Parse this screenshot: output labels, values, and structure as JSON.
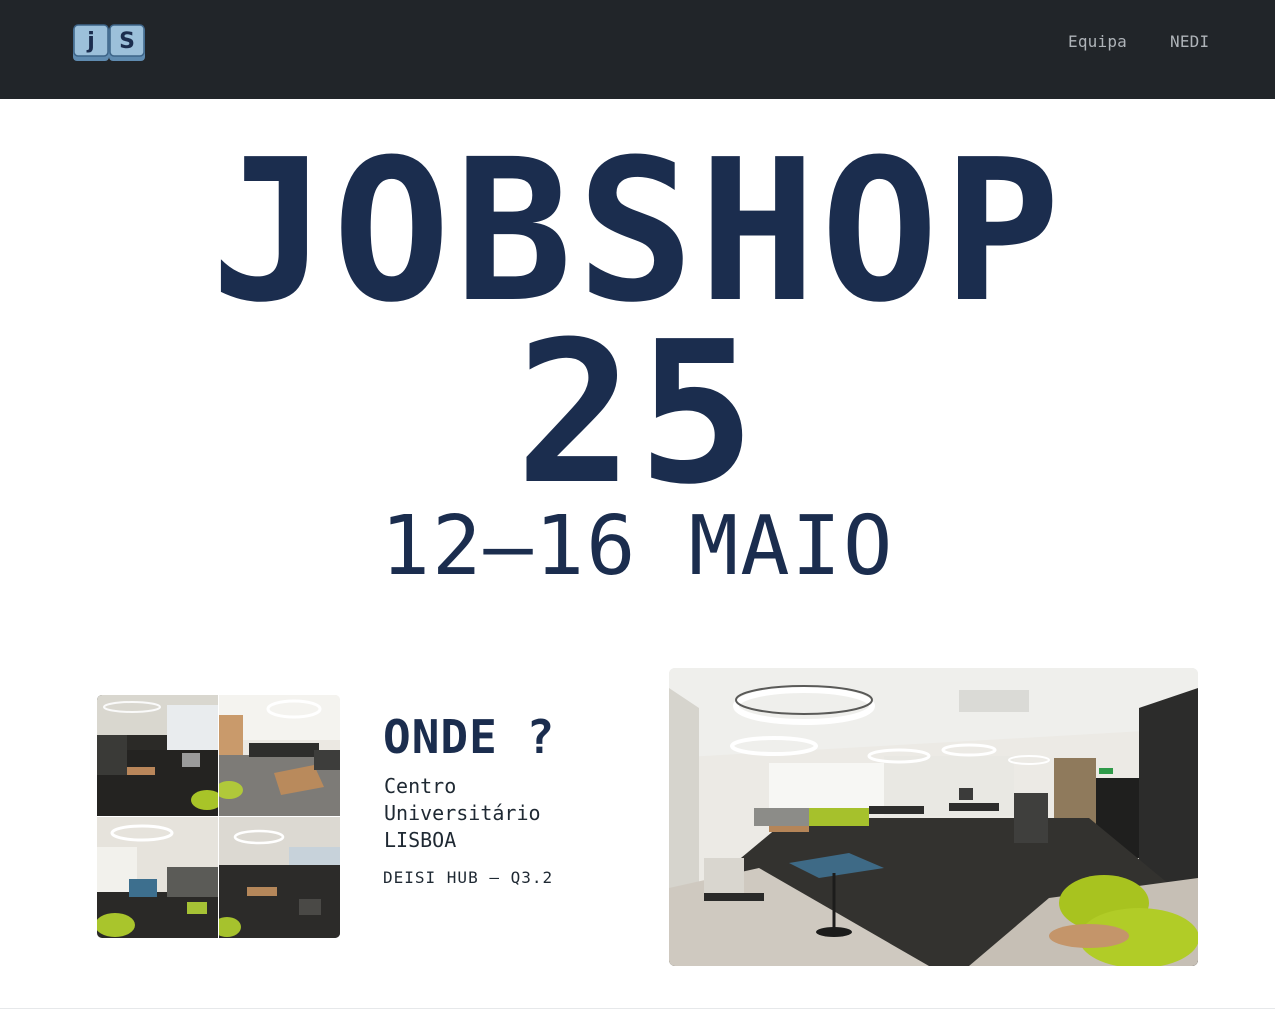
{
  "nav": {
    "logo": {
      "letters": [
        "j",
        "S"
      ],
      "icon": "keyboard-keys-logo",
      "color": "#8fb4cf"
    },
    "links": [
      {
        "label": "Equipa"
      },
      {
        "label": "NEDI"
      }
    ],
    "background": "#212529"
  },
  "hero": {
    "title_line1": "JOBSHOP",
    "title_line2": "25",
    "date": "12–16 MAIO",
    "color": "#1b2d4e"
  },
  "location": {
    "heading": "ONDE ?",
    "address_lines": [
      "Centro",
      "Universitário",
      "LISBOA"
    ],
    "room": "DEISI HUB – Q3.2",
    "collage_images": 4,
    "photo": "lounge-room-photo"
  }
}
